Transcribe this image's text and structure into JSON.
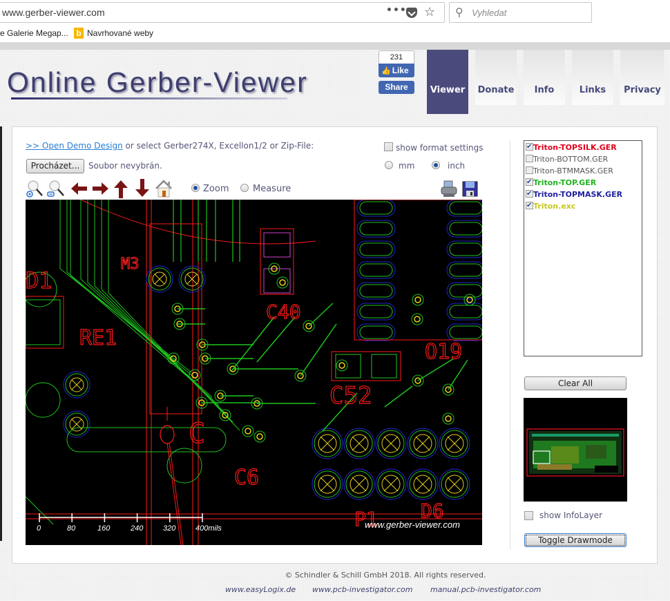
{
  "browser": {
    "url": "www.gerber-viewer.com",
    "search_placeholder": "Vyhledat",
    "page_actions_label": "•••",
    "bookmarks": [
      {
        "label": "e  Galerie Megap..."
      },
      {
        "label": "Navrhované weby",
        "icon": "bing-icon"
      }
    ]
  },
  "header": {
    "logo_text": "Online Gerber-Viewer",
    "facebook": {
      "count": "231",
      "like_label": "Like",
      "share_label": "Share"
    },
    "nav": [
      {
        "label": "Viewer",
        "active": true
      },
      {
        "label": "Donate",
        "active": false
      },
      {
        "label": "Info",
        "active": false
      },
      {
        "label": "Links",
        "active": false
      },
      {
        "label": "Privacy",
        "active": false
      }
    ]
  },
  "viewer": {
    "demo_link": ">> Open Demo Design",
    "demo_text": " or select Gerber274X, Excellon1/2 or Zip-File:",
    "browse_button": "Procházet...",
    "no_file_text": "Soubor nevybrán.",
    "show_format_settings": {
      "label": "show format settings",
      "checked": false
    },
    "units": [
      {
        "label": "mm",
        "selected": false
      },
      {
        "label": "inch",
        "selected": true
      }
    ],
    "tools": [
      "zoom-in-icon",
      "zoom-out-icon",
      "pan-left-icon",
      "pan-right-icon",
      "pan-up-icon",
      "pan-down-icon",
      "home-icon"
    ],
    "modes": [
      {
        "label": "Zoom",
        "selected": true
      },
      {
        "label": "Measure",
        "selected": false
      }
    ],
    "scale": {
      "ticks": [
        "0",
        "80",
        "160",
        "240",
        "320",
        "400mils"
      ]
    },
    "watermark": "www.gerber-viewer.com",
    "silkscreen_labels": [
      "D1",
      "M3",
      "RE1",
      "C40",
      "C52",
      "C",
      "C6",
      "O19",
      "D6",
      "P1"
    ]
  },
  "layers": [
    {
      "name": "Triton-TOPSILK.GER",
      "checked": true,
      "color": "#e0001a",
      "bold": true
    },
    {
      "name": "Triton-BOTTOM.GER",
      "checked": false,
      "color": "#555555",
      "bold": false
    },
    {
      "name": "Triton-BTMMASK.GER",
      "checked": false,
      "color": "#555555",
      "bold": false
    },
    {
      "name": "Triton-TOP.GER",
      "checked": true,
      "color": "#1fb31f",
      "bold": true
    },
    {
      "name": "Triton-TOPMASK.GER",
      "checked": true,
      "color": "#2020a0",
      "bold": true
    },
    {
      "name": "Triton.exc",
      "checked": true,
      "color": "#c8c820",
      "bold": true
    }
  ],
  "sidebar": {
    "clear_all": "Clear All",
    "show_info_layer": {
      "label": "show InfoLayer",
      "checked": false
    },
    "toggle_drawmode": "Toggle Drawmode"
  },
  "footer": {
    "copyright": "© Schindler & Schill GmbH 2018. All rights reserved.",
    "links": [
      "www.easyLogix.de",
      "www.pcb-investigator.com",
      "manual.pcb-investigator.com"
    ]
  },
  "colors": {
    "accent": "#4a4a7d",
    "link": "#2a7fd4",
    "pcb_background": "#000000",
    "silk": "#ff1a1a",
    "copper_top": "#1fc41f",
    "mask": "#2323d0",
    "drill": "#e6d21a"
  }
}
